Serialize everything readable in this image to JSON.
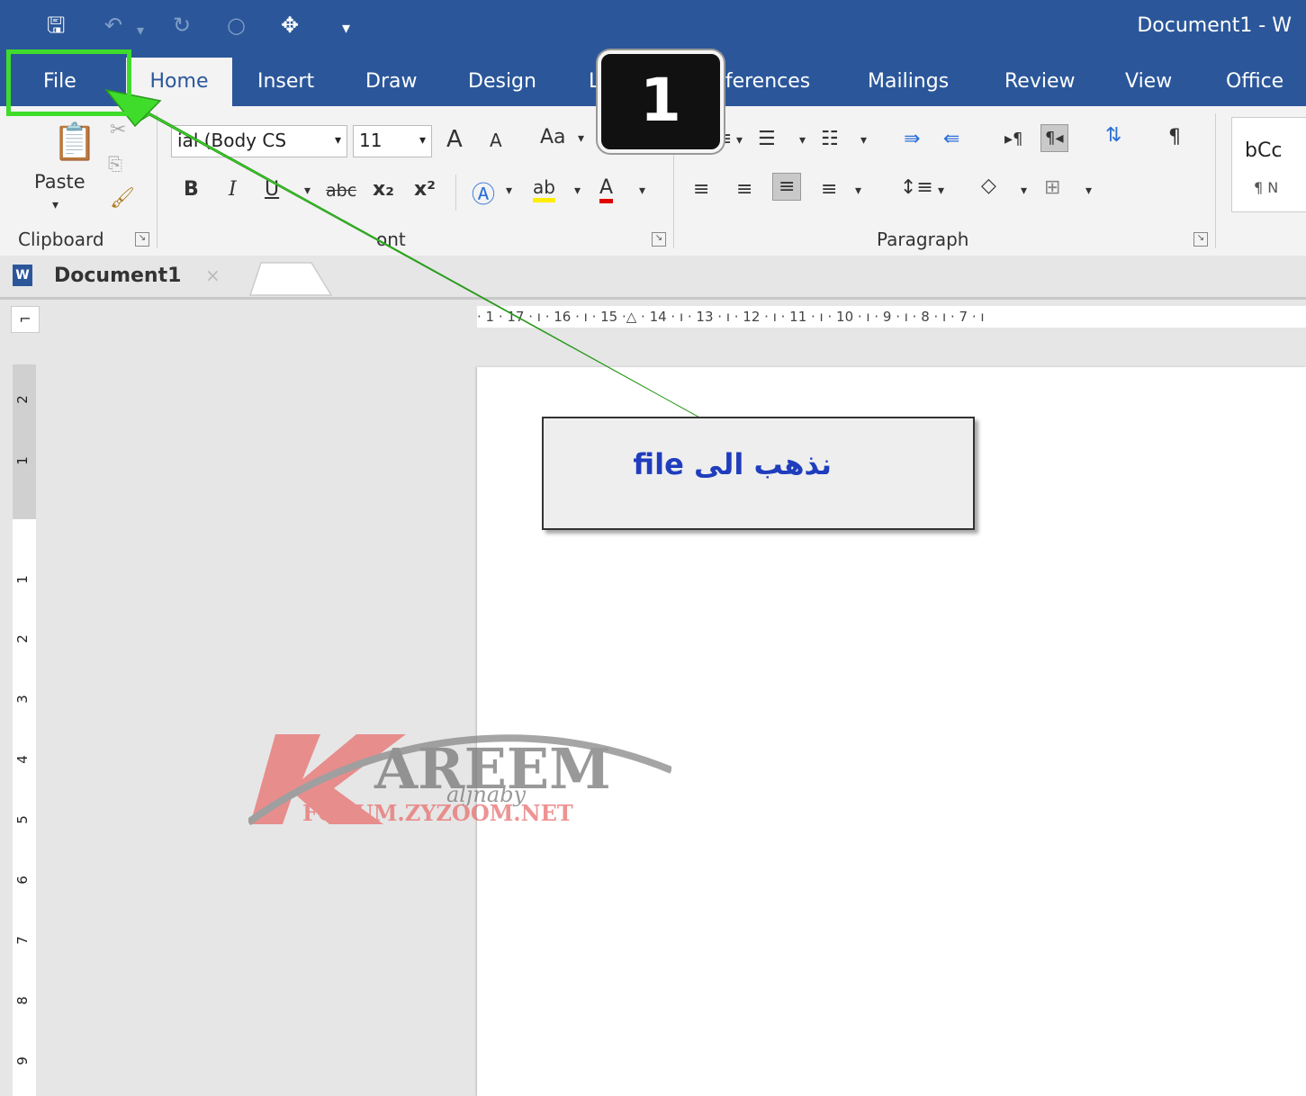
{
  "quick_access": {
    "title": "Document1 - W"
  },
  "tabs": [
    "File",
    "Home",
    "Insert",
    "Draw",
    "Design",
    "L",
    "References",
    "Mailings",
    "Review",
    "View",
    "Office"
  ],
  "clipboard": {
    "paste_label": "Paste",
    "group_label": "Clipboard"
  },
  "font": {
    "name": "ial (Body CS",
    "size": "11",
    "grow": "A",
    "shrink": "A",
    "case": "Aa",
    "bold": "B",
    "italic": "I",
    "strike": "abc",
    "sub": "x₂",
    "sup": "x²",
    "group_label": "ont"
  },
  "paragraph": {
    "group_label": "Paragraph"
  },
  "styles": {
    "preview_text": "bCc",
    "preview_label": "¶ N"
  },
  "doc_tab": {
    "label": "Document1"
  },
  "ruler": {
    "text": "· 1 · 17 · ı · 16 · ı · 15 ·△ · 14 · ı · 13 · ı · 12 · ı · 11 · ı · 10 · ı · 9 · ı · 8 · ı · 7 · ı"
  },
  "vruler": {
    "marks": [
      "2",
      "1",
      "1",
      "2",
      "3",
      "4",
      "5",
      "6",
      "7",
      "8",
      "9"
    ]
  },
  "callout": {
    "text": "نذهب الى file"
  },
  "step_badge": {
    "number": "1"
  },
  "watermark": {
    "brand": "AREEM",
    "script": "aljnaby",
    "site": "FORUM.ZYZOOM.NET"
  },
  "colors": {
    "word_blue": "#2b579a",
    "highlight_green": "#3fdc2b",
    "callout_text": "#1f3dbd"
  }
}
